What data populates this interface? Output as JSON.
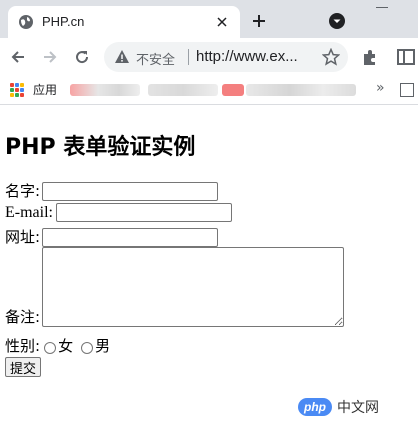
{
  "browser": {
    "tab": {
      "title": "PHP.cn",
      "favicon": "globe-icon"
    },
    "toolbar": {
      "security_status": "不安全",
      "url": "http://www.ex..."
    },
    "bookmarks": {
      "apps_label": "应用",
      "overflow": "»"
    }
  },
  "page": {
    "heading": "PHP 表单验证实例",
    "form": {
      "name_label": "名字:",
      "email_label": "E-mail:",
      "website_label": "网址:",
      "comment_label": "备注:",
      "gender_label": "性别:",
      "gender_options": [
        "女",
        "男"
      ],
      "submit_label": "提交"
    },
    "watermark": {
      "logo": "php",
      "text": "中文网"
    }
  },
  "colors": {
    "tabstrip_bg": "#dee1e6",
    "omnibox_bg": "#f1f3f4",
    "watermark_logo": "#4a8af4"
  }
}
